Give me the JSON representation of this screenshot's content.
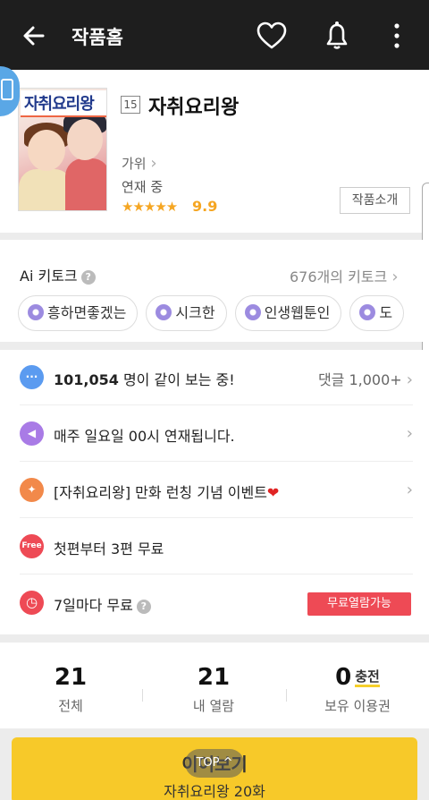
{
  "appbar": {
    "title": "작품홈"
  },
  "work": {
    "age_badge": "15",
    "title": "자취요리왕",
    "cover_title": "자취요리왕",
    "author": "가위",
    "status": "연재 중",
    "stars": "★★★★★",
    "rating": "9.9",
    "intro_button": "작품소개"
  },
  "talk": {
    "title": "Ai 키토크",
    "help": "?",
    "count": "676개의 키토크",
    "chips": [
      "흥하면좋겠는",
      "시크한",
      "인생웹툰인",
      "도"
    ]
  },
  "info": {
    "viewers_count": "101,054",
    "viewers_text": " 명이 같이 보는 중!",
    "comments": "댓글 1,000+",
    "schedule": "매주 일요일 00시 연재됩니다.",
    "event": "[자취요리왕] 만화 런칭 기념 이벤트",
    "event_heart": "❤",
    "free_icon": "Free",
    "free_text": "첫편부터 3편 무료",
    "wait_text": "7일마다 무료",
    "wait_badge": "무료열람가능"
  },
  "stats": {
    "total_num": "21",
    "total_label": "전체",
    "read_num": "21",
    "read_label": "내 열람",
    "ticket_num": "0",
    "charge_label": "충전",
    "ticket_label": "보유 이용권"
  },
  "cta": {
    "main": "이어보기",
    "sub": "자취요리왕 20화",
    "top": "TOP ^"
  },
  "colors": {
    "appbar": "#1e1e1e",
    "accent_yellow": "#f7c929",
    "star": "#f5a623",
    "badge_red": "#ee4a55"
  }
}
